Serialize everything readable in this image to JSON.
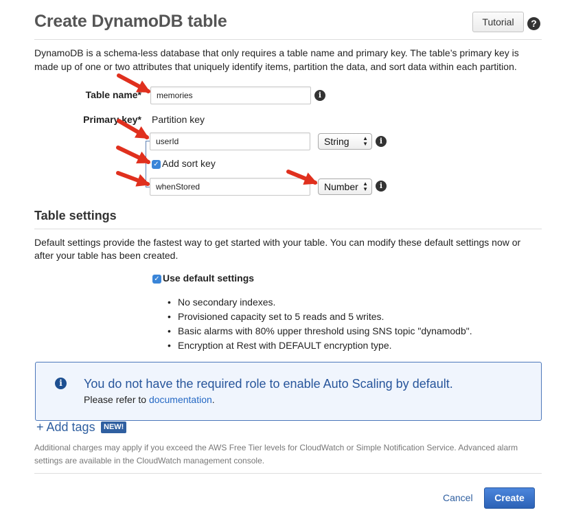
{
  "header": {
    "title": "Create DynamoDB table",
    "tutorial_label": "Tutorial",
    "help_glyph": "?"
  },
  "intro": "DynamoDB is a schema-less database that only requires a table name and primary key. The table’s primary key is made up of one or two attributes that uniquely identify items, partition the data, and sort data within each partition.",
  "form": {
    "table_name_label": "Table name*",
    "table_name_value": "memories",
    "primary_key_label": "Primary key*",
    "partition_key_label": "Partition key",
    "partition_key_value": "userId",
    "partition_key_type": "String",
    "add_sort_key_label": "Add sort key",
    "add_sort_key_checked": true,
    "sort_key_value": "whenStored",
    "sort_key_type": "Number"
  },
  "table_settings": {
    "title": "Table settings",
    "description": "Default settings provide the fastest way to get started with your table. You can modify these default settings now or after your table has been created.",
    "use_default_label": "Use default settings",
    "use_default_checked": true,
    "bullets": [
      "No secondary indexes.",
      "Provisioned capacity set to 5 reads and 5 writes.",
      "Basic alarms with 80% upper threshold using SNS topic \"dynamodb\".",
      "Encryption at Rest with DEFAULT encryption type."
    ]
  },
  "notice": {
    "title": "You do not have the required role to enable Auto Scaling by default.",
    "body_prefix": "Please refer to",
    "link_text": "documentation",
    "body_suffix": "."
  },
  "tags": {
    "add_tags_label": "+ Add tags",
    "new_badge": "NEW!"
  },
  "fineprint": "Additional charges may apply if you exceed the AWS Free Tier levels for CloudWatch or Simple Notification Service. Advanced alarm settings are available in the CloudWatch management console.",
  "footer": {
    "cancel_label": "Cancel",
    "create_label": "Create"
  },
  "icons": {
    "info": "info-icon",
    "help": "help-icon",
    "annotation": "red-arrow-icon"
  },
  "colors": {
    "accent": "#2f5fa0",
    "primary_button": "#3a72c8",
    "annotation_arrow": "#e0301e",
    "notice_border": "#4a76b9",
    "notice_bg": "#f0f5fd"
  }
}
